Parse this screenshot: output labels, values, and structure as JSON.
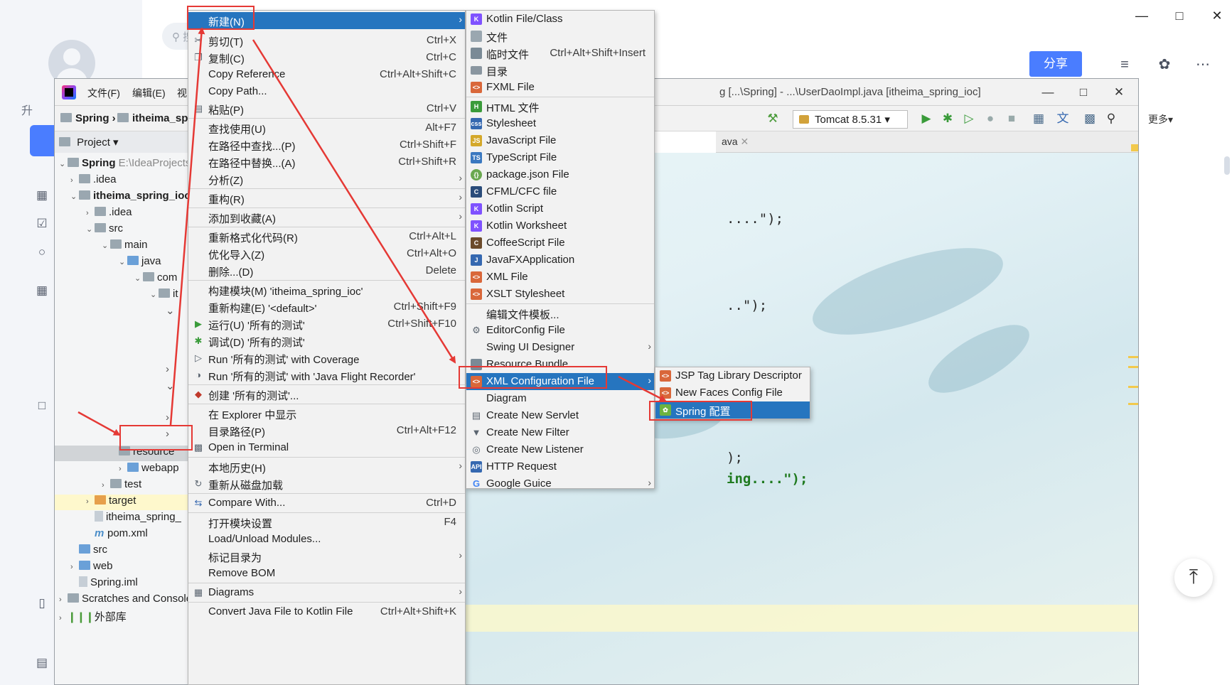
{
  "outer": {
    "search_placeholder": "搜",
    "left_label": "升",
    "share_label": "分享",
    "more_label": "更多",
    "to_top_icon": "arrow-up-icon"
  },
  "ide": {
    "menus": [
      "文件(F)",
      "编辑(E)",
      "视图(V"
    ],
    "title": "g [...\\Spring] - ...\\UserDaoImpl.java [itheima_spring_ioc]",
    "breadcrumbs": [
      "Spring",
      "itheima_spri"
    ],
    "run_config": "Tomcat 8.5.31",
    "tab_fragment": "ava",
    "project_label": "Project",
    "tree": [
      {
        "label": "Spring",
        "extra": "E:\\IdeaProjects"
      },
      {
        "label": ".idea"
      },
      {
        "label": "itheima_spring_ioc"
      },
      {
        "label": ".idea"
      },
      {
        "label": "src"
      },
      {
        "label": "main"
      },
      {
        "label": "java"
      },
      {
        "label": "com"
      },
      {
        "label": "it"
      },
      {
        "label": "resource"
      },
      {
        "label": "webapp"
      },
      {
        "label": "test"
      },
      {
        "label": "target"
      },
      {
        "label": "itheima_spring_"
      },
      {
        "label": "pom.xml"
      },
      {
        "label": "src"
      },
      {
        "label": "web"
      },
      {
        "label": "Spring.iml"
      },
      {
        "label": "Scratches and Console"
      },
      {
        "label": "外部库"
      }
    ],
    "code": [
      "....\");",
      "..\");",
      ");",
      "ing....\");"
    ]
  },
  "context_menu": [
    {
      "label": "新建(N)",
      "shortcut": "",
      "submenu": true,
      "selected": true
    },
    {
      "label": "剪切(T)",
      "shortcut": "Ctrl+X"
    },
    {
      "label": "复制(C)",
      "shortcut": "Ctrl+C"
    },
    {
      "label": "Copy Reference",
      "shortcut": "Ctrl+Alt+Shift+C"
    },
    {
      "label": "Copy Path...",
      "shortcut": ""
    },
    {
      "label": "粘贴(P)",
      "shortcut": "Ctrl+V"
    },
    {
      "label": "查找使用(U)",
      "shortcut": "Alt+F7"
    },
    {
      "label": "在路径中查找...(P)",
      "shortcut": "Ctrl+Shift+F"
    },
    {
      "label": "在路径中替换...(A)",
      "shortcut": "Ctrl+Shift+R"
    },
    {
      "label": "分析(Z)",
      "shortcut": "",
      "submenu": true
    },
    {
      "label": "重构(R)",
      "shortcut": "",
      "submenu": true
    },
    {
      "label": "添加到收藏(A)",
      "shortcut": "",
      "submenu": true
    },
    {
      "label": "重新格式化代码(R)",
      "shortcut": "Ctrl+Alt+L"
    },
    {
      "label": "优化导入(Z)",
      "shortcut": "Ctrl+Alt+O"
    },
    {
      "label": "删除...(D)",
      "shortcut": "Delete"
    },
    {
      "label": "构建模块(M) 'itheima_spring_ioc'",
      "shortcut": ""
    },
    {
      "label": "重新构建(E) '<default>'",
      "shortcut": "Ctrl+Shift+F9"
    },
    {
      "label": "运行(U) '所有的测试'",
      "shortcut": "Ctrl+Shift+F10"
    },
    {
      "label": "调试(D) '所有的测试'",
      "shortcut": ""
    },
    {
      "label": "Run '所有的测试' with Coverage",
      "shortcut": ""
    },
    {
      "label": "Run '所有的测试' with 'Java Flight Recorder'",
      "shortcut": ""
    },
    {
      "label": "创建 '所有的测试'...",
      "shortcut": ""
    },
    {
      "label": "在 Explorer 中显示",
      "shortcut": ""
    },
    {
      "label": "目录路径(P)",
      "shortcut": "Ctrl+Alt+F12"
    },
    {
      "label": "Open in Terminal",
      "shortcut": ""
    },
    {
      "label": "本地历史(H)",
      "shortcut": "",
      "submenu": true
    },
    {
      "label": "重新从磁盘加载",
      "shortcut": ""
    },
    {
      "label": "Compare With...",
      "shortcut": "Ctrl+D"
    },
    {
      "label": "打开模块设置",
      "shortcut": "F4"
    },
    {
      "label": "Load/Unload Modules...",
      "shortcut": ""
    },
    {
      "label": "标记目录为",
      "shortcut": "",
      "submenu": true
    },
    {
      "label": "Remove BOM",
      "shortcut": ""
    },
    {
      "label": "Diagrams",
      "shortcut": "",
      "submenu": true
    },
    {
      "label": "Convert Java File to Kotlin File",
      "shortcut": "Ctrl+Alt+Shift+K"
    }
  ],
  "new_menu": [
    {
      "label": "Kotlin File/Class"
    },
    {
      "label": "文件"
    },
    {
      "label": "临时文件",
      "shortcut": "Ctrl+Alt+Shift+Insert"
    },
    {
      "label": "目录"
    },
    {
      "label": "FXML File"
    },
    {
      "label": "HTML 文件"
    },
    {
      "label": "Stylesheet"
    },
    {
      "label": "JavaScript File"
    },
    {
      "label": "TypeScript File"
    },
    {
      "label": "package.json File"
    },
    {
      "label": "CFML/CFC file"
    },
    {
      "label": "Kotlin Script"
    },
    {
      "label": "Kotlin Worksheet"
    },
    {
      "label": "CoffeeScript File"
    },
    {
      "label": "JavaFXApplication"
    },
    {
      "label": "XML File"
    },
    {
      "label": "XSLT Stylesheet"
    },
    {
      "label": "编辑文件模板..."
    },
    {
      "label": "EditorConfig File"
    },
    {
      "label": "Swing UI Designer",
      "submenu": true
    },
    {
      "label": "Resource Bundle"
    },
    {
      "label": "XML Configuration File",
      "submenu": true,
      "selected": true
    },
    {
      "label": "Diagram"
    },
    {
      "label": "Create New Servlet"
    },
    {
      "label": "Create New Filter"
    },
    {
      "label": "Create New Listener"
    },
    {
      "label": "HTTP Request"
    },
    {
      "label": "Google Guice",
      "submenu": true
    }
  ],
  "xml_menu": [
    {
      "label": "JSP Tag Library Descriptor"
    },
    {
      "label": "New Faces Config File"
    },
    {
      "label": "Spring 配置",
      "selected": true
    }
  ],
  "colors": {
    "selection": "#2675bf",
    "annotation_red": "#e53935",
    "share_button": "#4a7dff"
  }
}
